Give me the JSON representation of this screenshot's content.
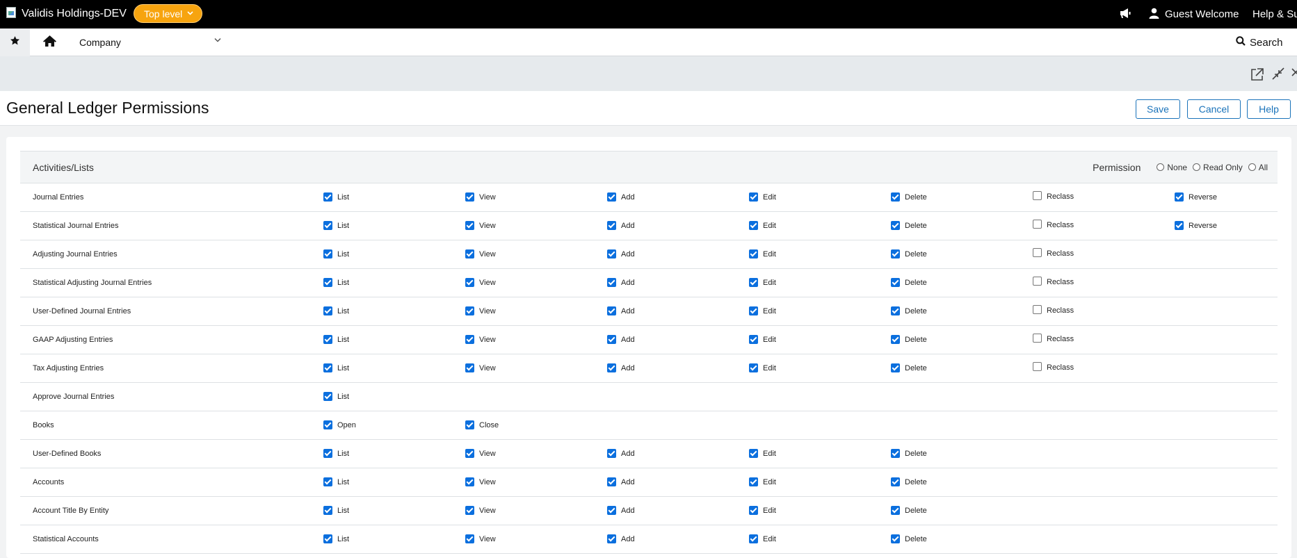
{
  "topbar": {
    "company_name": "Validis Holdings-DEV",
    "level_label": "Top level",
    "user_label": "Guest Welcome",
    "help_label": "Help & Su"
  },
  "navbar": {
    "module_label": "Company",
    "search_label": "Search"
  },
  "page": {
    "title": "General Ledger Permissions",
    "save_label": "Save",
    "cancel_label": "Cancel",
    "help_label": "Help"
  },
  "table": {
    "header_label": "Activities/Lists",
    "permission_label": "Permission",
    "permission_options": [
      "None",
      "Read Only",
      "All"
    ],
    "rows": [
      {
        "name": "Journal Entries",
        "perms": [
          {
            "label": "List",
            "checked": true
          },
          {
            "label": "View",
            "checked": true
          },
          {
            "label": "Add",
            "checked": true
          },
          {
            "label": "Edit",
            "checked": true
          },
          {
            "label": "Delete",
            "checked": true
          },
          {
            "label": "Reclass",
            "checked": false
          },
          {
            "label": "Reverse",
            "checked": true
          }
        ]
      },
      {
        "name": "Statistical Journal Entries",
        "perms": [
          {
            "label": "List",
            "checked": true
          },
          {
            "label": "View",
            "checked": true
          },
          {
            "label": "Add",
            "checked": true
          },
          {
            "label": "Edit",
            "checked": true
          },
          {
            "label": "Delete",
            "checked": true
          },
          {
            "label": "Reclass",
            "checked": false
          },
          {
            "label": "Reverse",
            "checked": true
          }
        ]
      },
      {
        "name": "Adjusting Journal Entries",
        "perms": [
          {
            "label": "List",
            "checked": true
          },
          {
            "label": "View",
            "checked": true
          },
          {
            "label": "Add",
            "checked": true
          },
          {
            "label": "Edit",
            "checked": true
          },
          {
            "label": "Delete",
            "checked": true
          },
          {
            "label": "Reclass",
            "checked": false
          }
        ]
      },
      {
        "name": "Statistical Adjusting Journal Entries",
        "perms": [
          {
            "label": "List",
            "checked": true
          },
          {
            "label": "View",
            "checked": true
          },
          {
            "label": "Add",
            "checked": true
          },
          {
            "label": "Edit",
            "checked": true
          },
          {
            "label": "Delete",
            "checked": true
          },
          {
            "label": "Reclass",
            "checked": false
          }
        ]
      },
      {
        "name": "User-Defined Journal Entries",
        "perms": [
          {
            "label": "List",
            "checked": true
          },
          {
            "label": "View",
            "checked": true
          },
          {
            "label": "Add",
            "checked": true
          },
          {
            "label": "Edit",
            "checked": true
          },
          {
            "label": "Delete",
            "checked": true
          },
          {
            "label": "Reclass",
            "checked": false
          }
        ]
      },
      {
        "name": "GAAP Adjusting Entries",
        "perms": [
          {
            "label": "List",
            "checked": true
          },
          {
            "label": "View",
            "checked": true
          },
          {
            "label": "Add",
            "checked": true
          },
          {
            "label": "Edit",
            "checked": true
          },
          {
            "label": "Delete",
            "checked": true
          },
          {
            "label": "Reclass",
            "checked": false
          }
        ]
      },
      {
        "name": "Tax Adjusting Entries",
        "perms": [
          {
            "label": "List",
            "checked": true
          },
          {
            "label": "View",
            "checked": true
          },
          {
            "label": "Add",
            "checked": true
          },
          {
            "label": "Edit",
            "checked": true
          },
          {
            "label": "Delete",
            "checked": true
          },
          {
            "label": "Reclass",
            "checked": false
          }
        ]
      },
      {
        "name": "Approve Journal Entries",
        "perms": [
          {
            "label": "List",
            "checked": true
          }
        ]
      },
      {
        "name": "Books",
        "perms": [
          {
            "label": "Open",
            "checked": true
          },
          {
            "label": "Close",
            "checked": true
          }
        ]
      },
      {
        "name": "User-Defined Books",
        "perms": [
          {
            "label": "List",
            "checked": true
          },
          {
            "label": "View",
            "checked": true
          },
          {
            "label": "Add",
            "checked": true
          },
          {
            "label": "Edit",
            "checked": true
          },
          {
            "label": "Delete",
            "checked": true
          }
        ]
      },
      {
        "name": "Accounts",
        "perms": [
          {
            "label": "List",
            "checked": true
          },
          {
            "label": "View",
            "checked": true
          },
          {
            "label": "Add",
            "checked": true
          },
          {
            "label": "Edit",
            "checked": true
          },
          {
            "label": "Delete",
            "checked": true
          }
        ]
      },
      {
        "name": "Account Title By Entity",
        "perms": [
          {
            "label": "List",
            "checked": true
          },
          {
            "label": "View",
            "checked": true
          },
          {
            "label": "Add",
            "checked": true
          },
          {
            "label": "Edit",
            "checked": true
          },
          {
            "label": "Delete",
            "checked": true
          }
        ]
      },
      {
        "name": "Statistical Accounts",
        "perms": [
          {
            "label": "List",
            "checked": true
          },
          {
            "label": "View",
            "checked": true
          },
          {
            "label": "Add",
            "checked": true
          },
          {
            "label": "Edit",
            "checked": true
          },
          {
            "label": "Delete",
            "checked": true
          }
        ]
      }
    ]
  },
  "colors": {
    "accent": "#1a73ba",
    "checkbox": "#0b6fde",
    "level_pill": "#f7a40f"
  },
  "icons": [
    "broken-image-icon",
    "chevron-down-icon",
    "megaphone-icon",
    "user-icon",
    "star-icon",
    "home-icon",
    "search-icon",
    "open-new-window-icon",
    "collapse-icon",
    "close-icon"
  ]
}
